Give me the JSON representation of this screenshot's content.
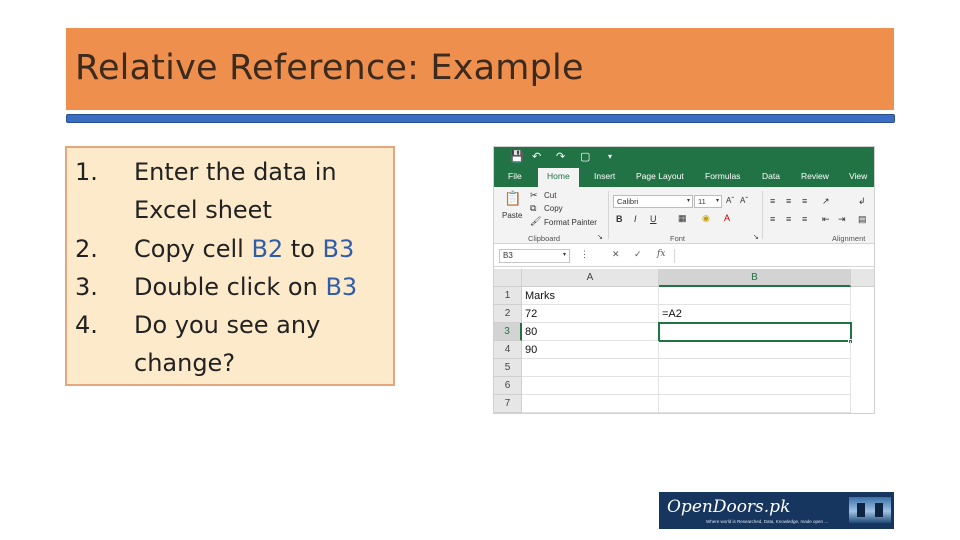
{
  "slide": {
    "title": "Relative Reference: Example",
    "steps": [
      {
        "num": "1.",
        "parts": [
          "Enter the data in Excel sheet"
        ]
      },
      {
        "num": "2.",
        "parts": [
          "Copy cell ",
          "B2",
          " to ",
          "B3"
        ]
      },
      {
        "num": "3.",
        "parts": [
          "Double click on ",
          "B3"
        ]
      },
      {
        "num": "4.",
        "parts": [
          "Do you see any change?"
        ]
      }
    ],
    "colors": {
      "title_bg": "#ee8f4d",
      "rule": "#3b6dc2",
      "box_bg": "#fdeacb",
      "box_border": "#e3a67d",
      "cell_ref": "#2f5da8"
    }
  },
  "excel": {
    "qat_icons": [
      "save-icon",
      "undo-icon",
      "redo-icon",
      "touch-mode-icon",
      "customize-icon"
    ],
    "tabs": [
      "File",
      "Home",
      "Insert",
      "Page Layout",
      "Formulas",
      "Data",
      "Review",
      "View"
    ],
    "active_tab": "Home",
    "ribbon": {
      "paste": "Paste",
      "cut": "Cut",
      "copy": "Copy",
      "format_painter": "Format Painter",
      "clipboard_group": "Clipboard",
      "font_name": "Calibri",
      "font_size": "11",
      "bold": "B",
      "italic": "I",
      "underline": "U",
      "font_group": "Font",
      "alignment_group": "Alignment"
    },
    "name_box": "B3",
    "formula_symbol": "fx",
    "columns": [
      "A",
      "B"
    ],
    "rows": [
      "1",
      "2",
      "3",
      "4",
      "5",
      "6",
      "7"
    ],
    "cells": {
      "A1": "Marks",
      "A2": "72",
      "A3": "80",
      "A4": "90",
      "B2": "=A2"
    },
    "active_cell": "B3",
    "accent": "#217346"
  },
  "logo": {
    "name": "OpenDoors.pk",
    "tagline": "Where world is Researched, Data, Knowledge, made open ..."
  }
}
